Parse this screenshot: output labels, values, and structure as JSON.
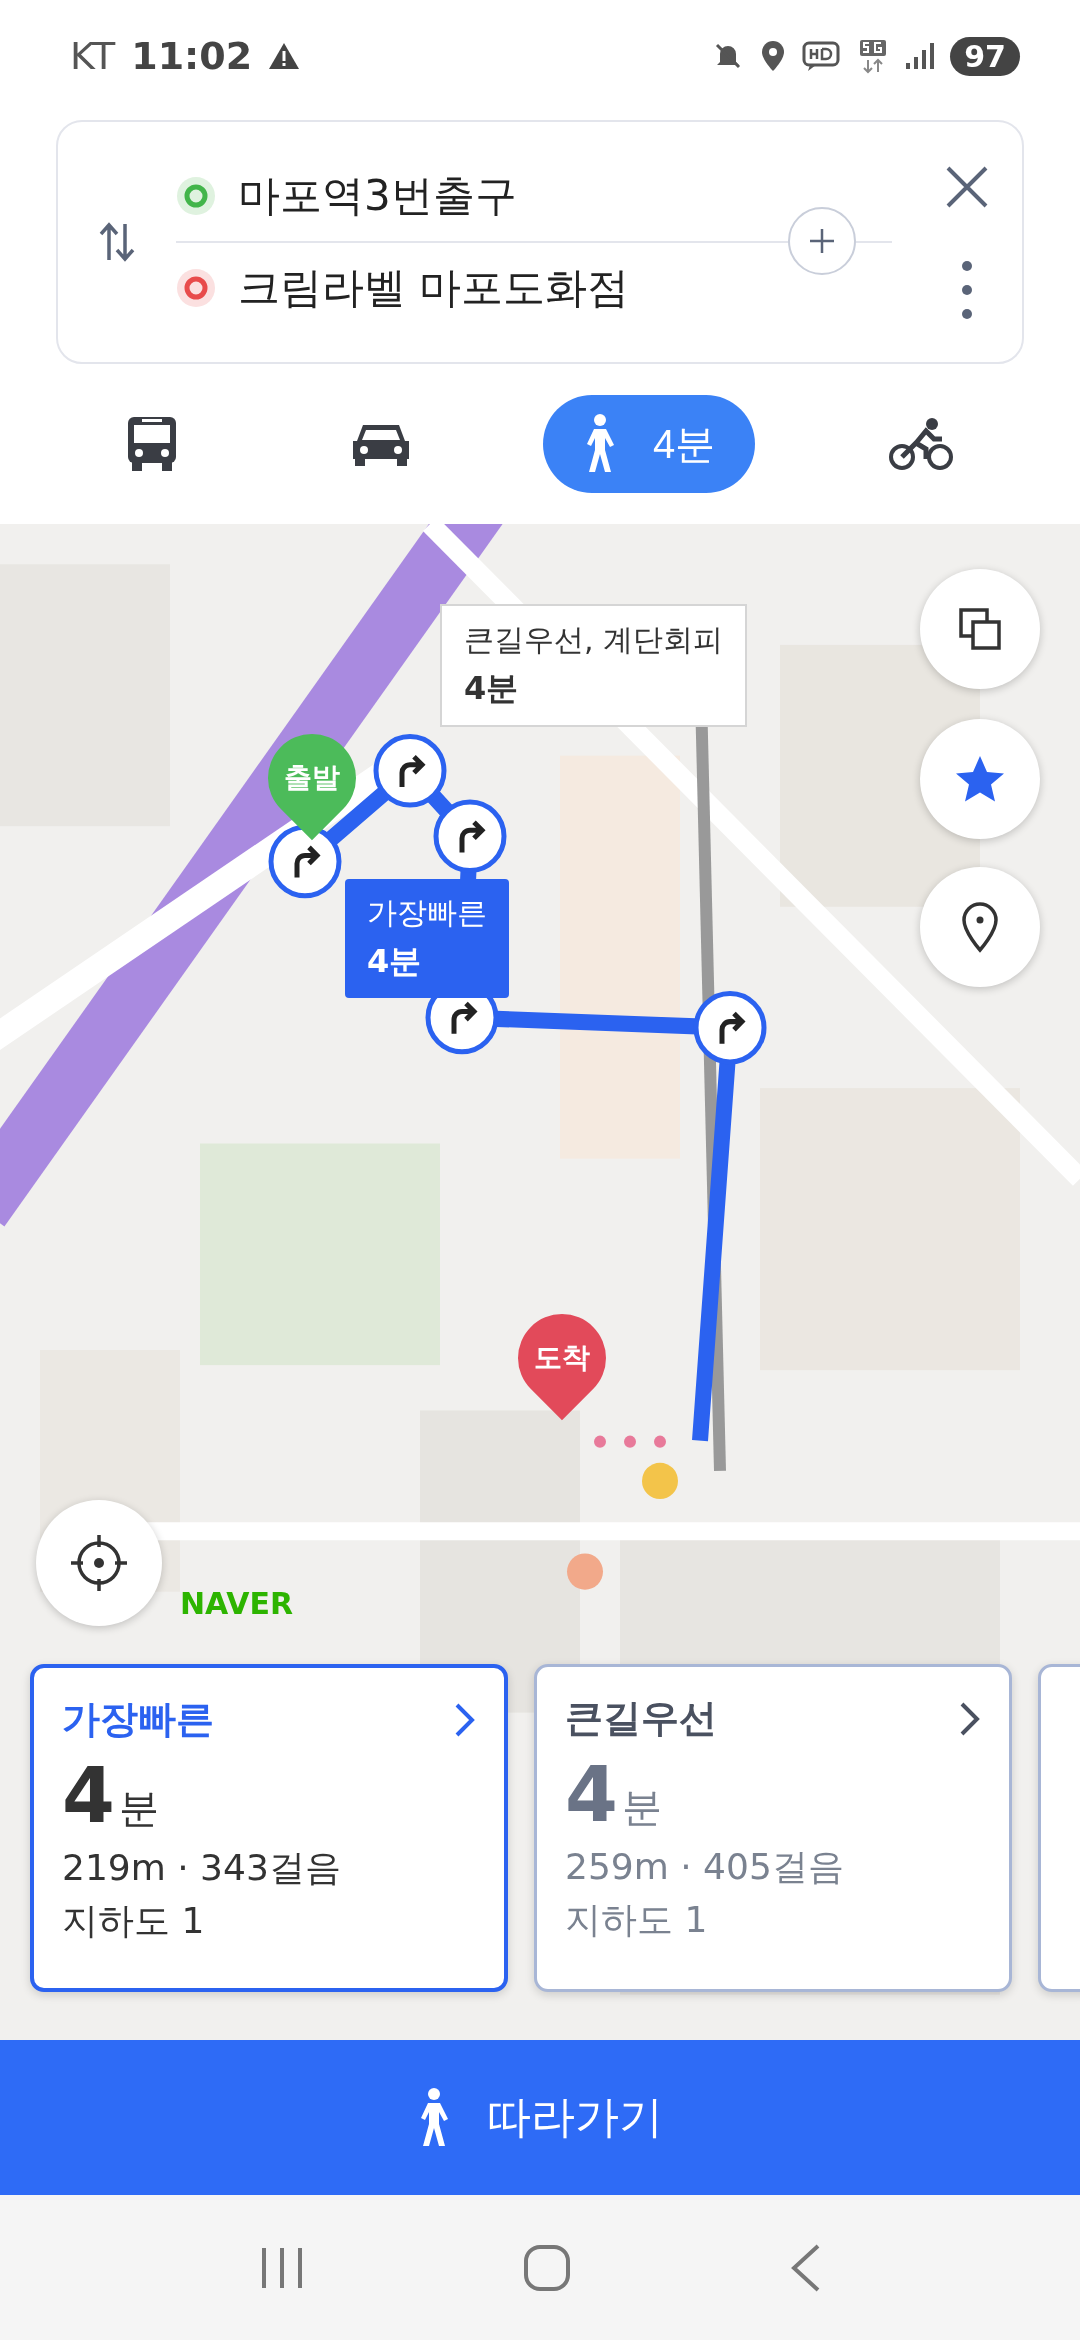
{
  "status_bar": {
    "carrier": "KT",
    "time": "11:02",
    "battery": "97"
  },
  "route_search": {
    "origin": "마포역3번출구",
    "destination": "크림라벨 마포도화점"
  },
  "modes": [
    {
      "kind": "bus",
      "selected": false
    },
    {
      "kind": "car",
      "selected": false
    },
    {
      "kind": "walk",
      "selected": true,
      "label": "4분"
    },
    {
      "kind": "bike",
      "selected": false
    }
  ],
  "map": {
    "callouts": [
      {
        "kind": "alt",
        "title": "큰길우선, 계단회피",
        "time": "4분"
      },
      {
        "kind": "main",
        "title": "가장빠른",
        "time": "4분"
      }
    ],
    "start_pin": "출발",
    "end_pin": "도착",
    "logo": "NAVER"
  },
  "route_cards": [
    {
      "title": "가장빠른",
      "time": "4",
      "unit": "분",
      "distance": "219m · 343걸음",
      "detail": "지하도 1",
      "selected": true
    },
    {
      "title": "큰길우선",
      "time": "4",
      "unit": "분",
      "distance": "259m · 405걸음",
      "detail": "지하도 1",
      "selected": false
    }
  ],
  "follow_button": "따라가기"
}
